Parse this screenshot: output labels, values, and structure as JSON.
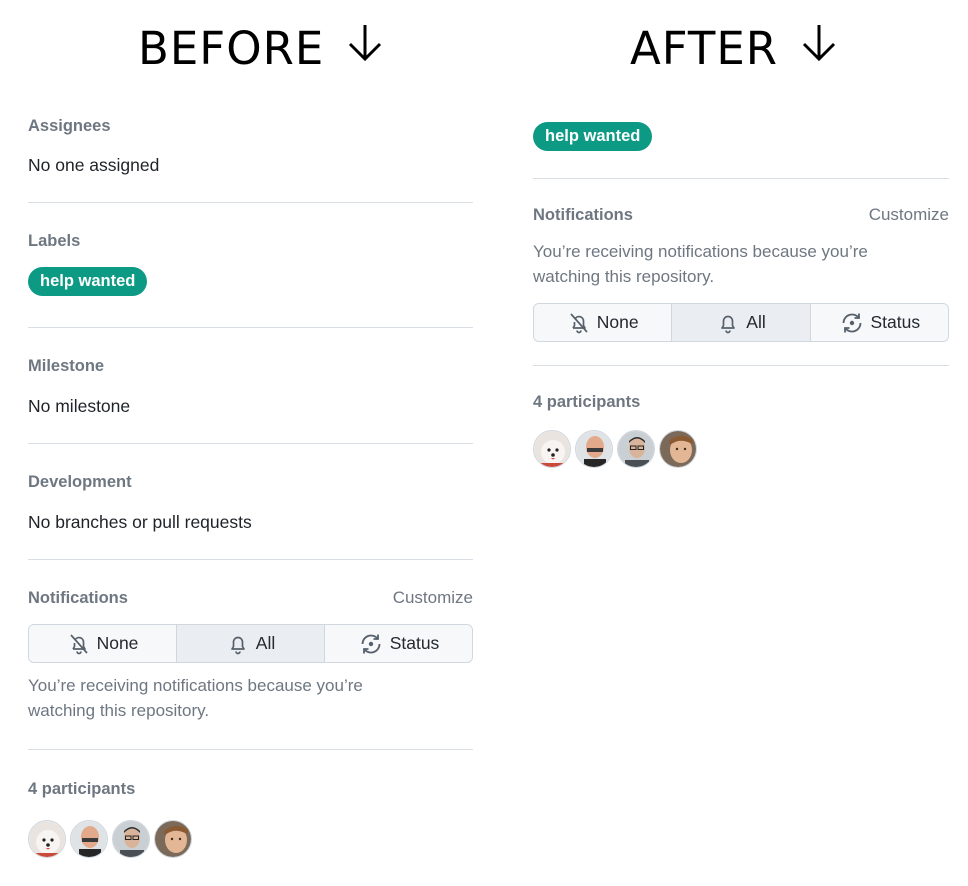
{
  "headings": {
    "before": "BEFORE",
    "after": "AFTER"
  },
  "arrow_icon": "arrow-down-icon",
  "before": {
    "assignees": {
      "title": "Assignees",
      "value": "No one assigned"
    },
    "labels": {
      "title": "Labels",
      "items": [
        {
          "text": "help wanted",
          "color": "#0d9a85"
        }
      ]
    },
    "milestone": {
      "title": "Milestone",
      "value": "No milestone"
    },
    "development": {
      "title": "Development",
      "value": "No branches or pull requests"
    },
    "notifications": {
      "title": "Notifications",
      "customize": "Customize",
      "options": [
        {
          "label": "None",
          "icon": "bell-slash-icon"
        },
        {
          "label": "All",
          "icon": "bell-icon",
          "selected": true
        },
        {
          "label": "Status",
          "icon": "sync-status-icon"
        }
      ],
      "reason": "You’re receiving notifications because you’re watching this repository."
    },
    "participants": {
      "title": "4 participants",
      "count": 4
    }
  },
  "after": {
    "labels": {
      "items": [
        {
          "text": "help wanted",
          "color": "#0d9a85"
        }
      ]
    },
    "notifications": {
      "title": "Notifications",
      "customize": "Customize",
      "reason": "You’re receiving notifications because you’re watching this repository.",
      "options": [
        {
          "label": "None",
          "icon": "bell-slash-icon"
        },
        {
          "label": "All",
          "icon": "bell-icon",
          "selected": true
        },
        {
          "label": "Status",
          "icon": "sync-status-icon"
        }
      ]
    },
    "participants": {
      "title": "4 participants",
      "count": 4
    }
  }
}
